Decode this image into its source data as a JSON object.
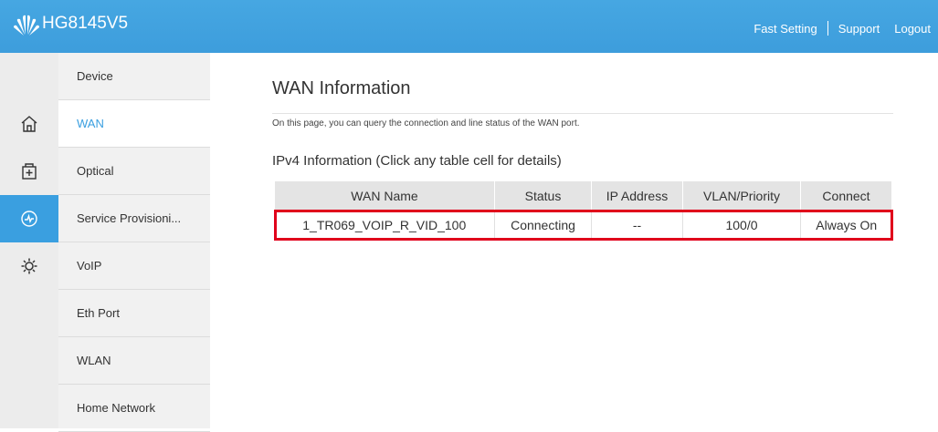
{
  "header": {
    "model": "HG8145V5",
    "links": {
      "fast_setting": "Fast Setting",
      "support": "Support",
      "logout": "Logout"
    },
    "colors": {
      "bar": "#3d9ddc",
      "accent": "#3a9fe0"
    }
  },
  "rail": {
    "items": [
      {
        "icon": "home-icon"
      },
      {
        "icon": "add-box-icon"
      },
      {
        "icon": "status-gauge-icon",
        "active": true
      },
      {
        "icon": "gear-icon"
      }
    ]
  },
  "menu": {
    "items": [
      {
        "label": "Device"
      },
      {
        "label": "WAN",
        "active": true
      },
      {
        "label": "Optical"
      },
      {
        "label": "Service Provisioni..."
      },
      {
        "label": "VoIP"
      },
      {
        "label": "Eth Port"
      },
      {
        "label": "WLAN"
      },
      {
        "label": "Home Network"
      }
    ]
  },
  "content": {
    "title": "WAN Information",
    "description": "On this page, you can query the connection and line status of the WAN port.",
    "section_title": "IPv4 Information (Click any table cell for details)",
    "table": {
      "headers": [
        "WAN Name",
        "Status",
        "IP Address",
        "VLAN/Priority",
        "Connect"
      ],
      "rows": [
        [
          "1_TR069_VOIP_R_VID_100",
          "Connecting",
          "--",
          "100/0",
          "Always On"
        ]
      ],
      "highlight_color": "#e0001b"
    }
  }
}
